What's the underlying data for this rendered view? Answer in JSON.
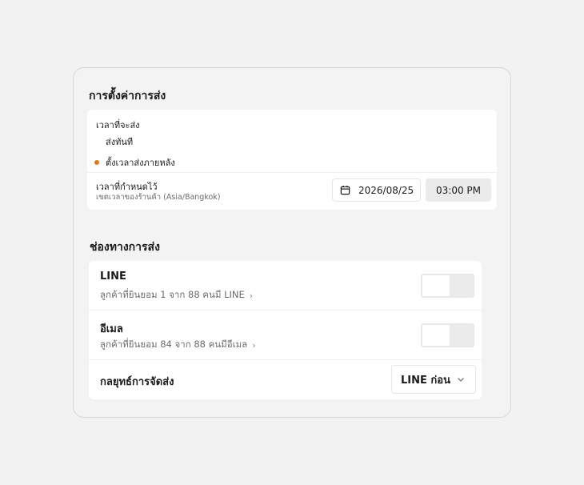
{
  "schedule": {
    "title": "การตั้งค่าการส่ง",
    "when_label": "เวลาที่จะส่ง",
    "options": [
      {
        "label": "ส่งทันที",
        "selected": false
      },
      {
        "label": "ตั้งเวลาส่งภายหลัง",
        "selected": true
      }
    ],
    "scheduled_label": "เวลาที่กำหนดไว้",
    "timezone_note": "เขตเวลาของร้านค้า (Asia/Bangkok)",
    "date_value": "2026/08/25",
    "time_value": "03:00 PM",
    "accent_color": "#e07b1a"
  },
  "channels": {
    "title": "ช่องทางการส่ง",
    "items": [
      {
        "name": "LINE",
        "detail": "ลูกค้าที่ยินยอม 1 จาก 88 คนมี LINE",
        "enabled": false
      },
      {
        "name": "อีเมล",
        "detail": "ลูกค้าที่ยินยอม 84 จาก 88 คนมีอีเมล",
        "enabled": false
      }
    ],
    "strategy_label": "กลยุทธ์การจัดส่ง",
    "strategy_value": "LINE ก่อน"
  }
}
